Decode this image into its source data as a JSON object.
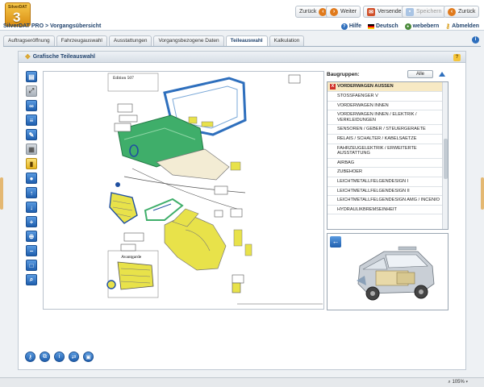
{
  "app": {
    "logo_text": "SilverDAT",
    "logo_number": "3",
    "breadcrumb": "SilverDAT PRO > Vorgangsübersicht"
  },
  "header_buttons": {
    "back": "Zurück",
    "forward": "Weiter",
    "send": "Versenden",
    "save": "Speichern",
    "back2": "Zurück"
  },
  "top_links": {
    "help": "Hilfe",
    "language": "Deutsch",
    "user": "webebern",
    "logout": "Abmelden"
  },
  "tabs": [
    {
      "label": "Auftragseröffnung",
      "active": false
    },
    {
      "label": "Fahrzeugauswahl",
      "active": false
    },
    {
      "label": "Ausstattungen",
      "active": false
    },
    {
      "label": "Vorgangsbezogene Daten",
      "active": false
    },
    {
      "label": "Teileauswahl",
      "active": true
    },
    {
      "label": "Kalkulation",
      "active": false
    }
  ],
  "panel": {
    "title": "Grafische Teileauswahl"
  },
  "drawing": {
    "label_top": "Edition 507",
    "label_bottom": "Avantgarde"
  },
  "baugruppen": {
    "label": "Baugruppen:",
    "all_button": "Alle",
    "items": [
      {
        "label": "VORDERWAGEN AUSSEN",
        "selected": true
      },
      {
        "label": "STOSSFAENGER V",
        "selected": false
      },
      {
        "label": "VORDERWAGEN INNEN",
        "selected": false
      },
      {
        "label": "VORDERWAGEN INNEN / ELEKTRIK / VERKLEIDUNGEN",
        "selected": false
      },
      {
        "label": "SENSOREN / GEBER / STEUERGERAETE",
        "selected": false
      },
      {
        "label": "RELAIS / SCHALTER / KABELSAETZE",
        "selected": false
      },
      {
        "label": "FAHRZEUGELEKTRIK / ERWEITERTE AUSSTATTUNG",
        "selected": false
      },
      {
        "label": "AIRBAG",
        "selected": false
      },
      {
        "label": "ZUBEHOER",
        "selected": false
      },
      {
        "label": "LEICHTMETALLFELGENDESIGN I",
        "selected": false
      },
      {
        "label": "LEICHTMETALLFELGENDESIGN II",
        "selected": false
      },
      {
        "label": "LEICHTMETALLFELGENDESIGN AMG / INCENIO",
        "selected": false
      },
      {
        "label": "HYDRAULIKBREMSEINHEIT",
        "selected": false
      }
    ]
  },
  "status": {
    "zoom": "105%"
  },
  "colors": {
    "accent_blue": "#2e6fbd",
    "part_green": "#3fae6a",
    "part_yellow": "#e8e24a",
    "selected_row": "#f7e9c4"
  }
}
